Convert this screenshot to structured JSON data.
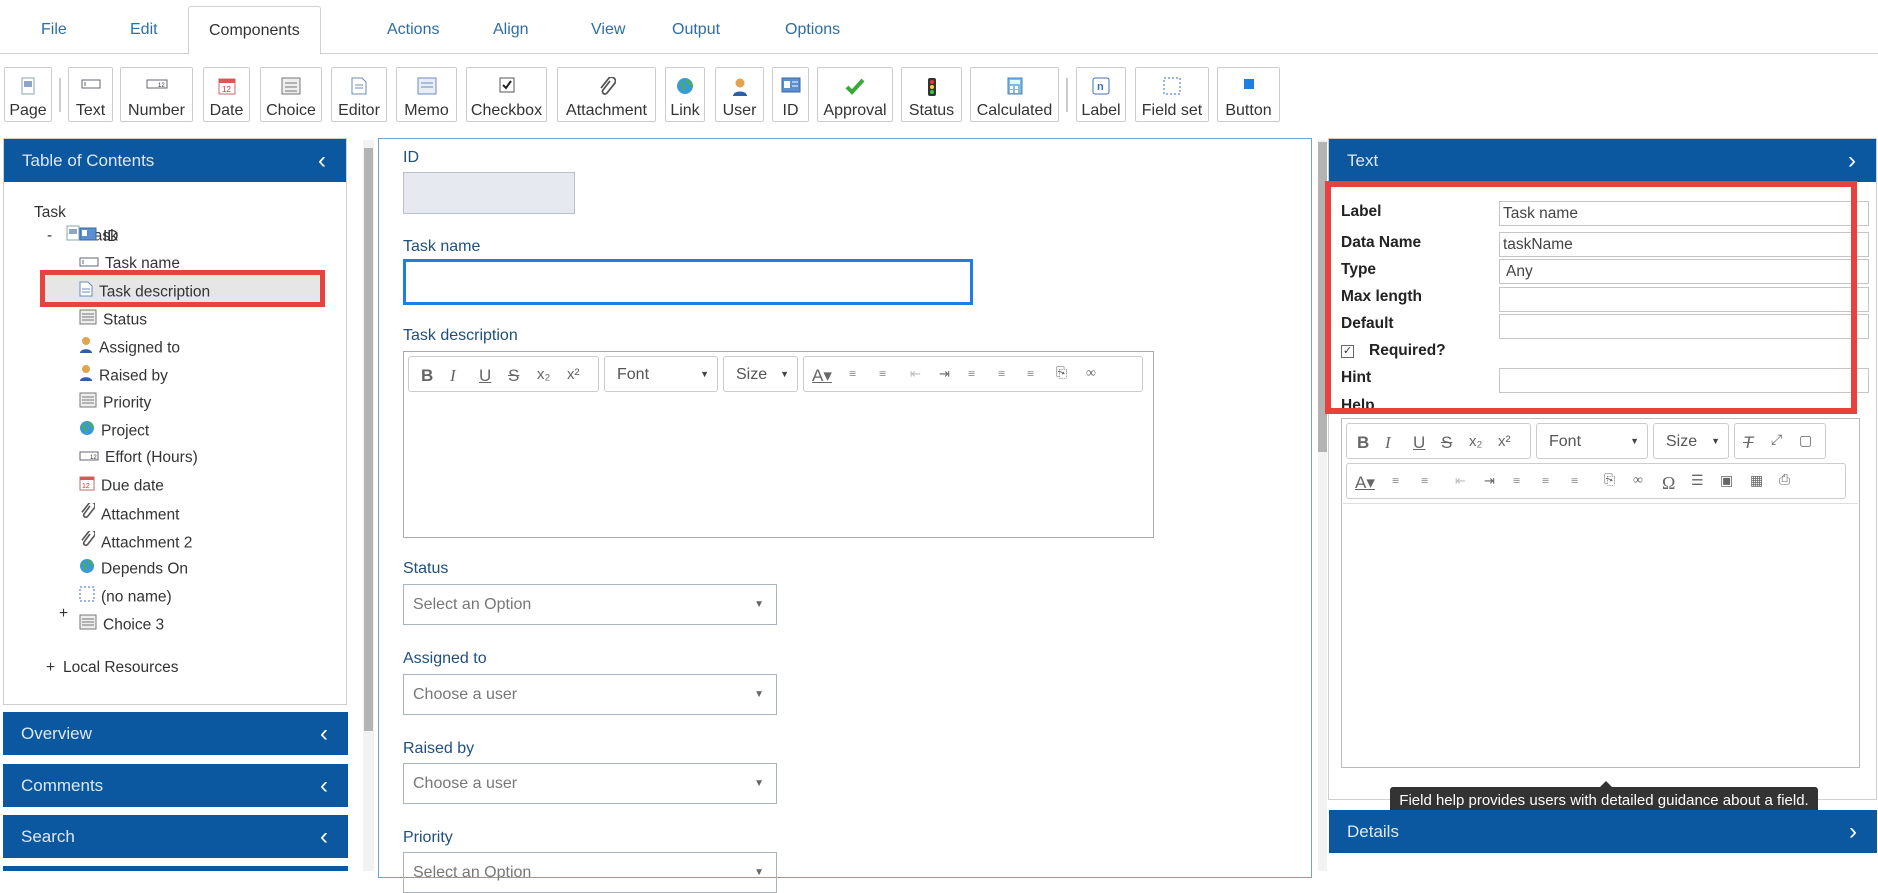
{
  "menu": {
    "tabs": [
      "File",
      "Edit",
      "Components",
      "Actions",
      "Align",
      "View",
      "Output",
      "Options"
    ]
  },
  "toolbar": {
    "buttons": [
      {
        "label": "Page",
        "icon": "page-icon"
      },
      {
        "label": "Text",
        "icon": "text-field-icon"
      },
      {
        "label": "Number",
        "icon": "number-icon"
      },
      {
        "label": "Date",
        "icon": "calendar-icon"
      },
      {
        "label": "Choice",
        "icon": "choice-icon"
      },
      {
        "label": "Editor",
        "icon": "editor-icon"
      },
      {
        "label": "Memo",
        "icon": "memo-icon"
      },
      {
        "label": "Checkbox",
        "icon": "checkbox-icon"
      },
      {
        "label": "Attachment",
        "icon": "paperclip-icon"
      },
      {
        "label": "Link",
        "icon": "globe-icon"
      },
      {
        "label": "User",
        "icon": "user-icon"
      },
      {
        "label": "ID",
        "icon": "id-card-icon"
      },
      {
        "label": "Approval",
        "icon": "checkmark-icon"
      },
      {
        "label": "Status",
        "icon": "traffic-light-icon"
      },
      {
        "label": "Calculated",
        "icon": "calculator-icon"
      },
      {
        "label": "Label",
        "icon": "label-icon"
      },
      {
        "label": "Field set",
        "icon": "fieldset-icon"
      },
      {
        "label": "Button",
        "icon": "button-icon"
      }
    ]
  },
  "toc": {
    "title": "Table of Contents",
    "root": "Task",
    "collapse": "-",
    "task_node": "Task",
    "items": [
      {
        "label": "ID",
        "icon": "id-card-icon"
      },
      {
        "label": "Task name",
        "icon": "text-field-icon"
      },
      {
        "label": "Task description",
        "icon": "editor-icon"
      },
      {
        "label": "Status",
        "icon": "choice-icon"
      },
      {
        "label": "Assigned to",
        "icon": "user-icon"
      },
      {
        "label": "Raised by",
        "icon": "user-icon"
      },
      {
        "label": "Priority",
        "icon": "choice-icon"
      },
      {
        "label": "Project",
        "icon": "globe-icon"
      },
      {
        "label": "Effort (Hours)",
        "icon": "number-icon"
      },
      {
        "label": "Due date",
        "icon": "calendar-icon"
      },
      {
        "label": "Attachment",
        "icon": "paperclip-icon"
      },
      {
        "label": "Attachment 2",
        "icon": "paperclip-icon"
      },
      {
        "label": "Depends On",
        "icon": "globe-icon"
      },
      {
        "label": "(no name)",
        "icon": "fieldset-icon"
      },
      {
        "label": "Choice 3",
        "icon": "choice-icon"
      }
    ],
    "expand": "+",
    "local_resources": "Local Resources"
  },
  "left_panels": [
    "Overview",
    "Comments",
    "Search"
  ],
  "form": {
    "id_label": "ID",
    "task_name_label": "Task name",
    "task_description_label": "Task description",
    "rte_font": "Font",
    "rte_size": "Size",
    "status_label": "Status",
    "status_placeholder": "Select an Option",
    "assigned_label": "Assigned to",
    "assigned_placeholder": "Choose a user",
    "raised_label": "Raised by",
    "raised_placeholder": "Choose a user",
    "priority_label": "Priority",
    "priority_placeholder": "Select an Option"
  },
  "props": {
    "title": "Text",
    "label_label": "Label",
    "label_value": "Task name",
    "dataname_label": "Data Name",
    "dataname_value": "taskName",
    "type_label": "Type",
    "type_value": "Any",
    "maxlength_label": "Max length",
    "maxlength_value": "",
    "default_label": "Default",
    "default_value": "",
    "required_label": "Required?",
    "required_checked": true,
    "hint_label": "Hint",
    "hint_value": "",
    "help_label": "Help",
    "help_font": "Font",
    "help_size": "Size"
  },
  "tooltip": "Field help provides users with detailed guidance about a field.",
  "details_title": "Details",
  "colors": {
    "accent": "#0c58a0",
    "highlight": "#e8423f",
    "focus": "#1e7fe0"
  }
}
